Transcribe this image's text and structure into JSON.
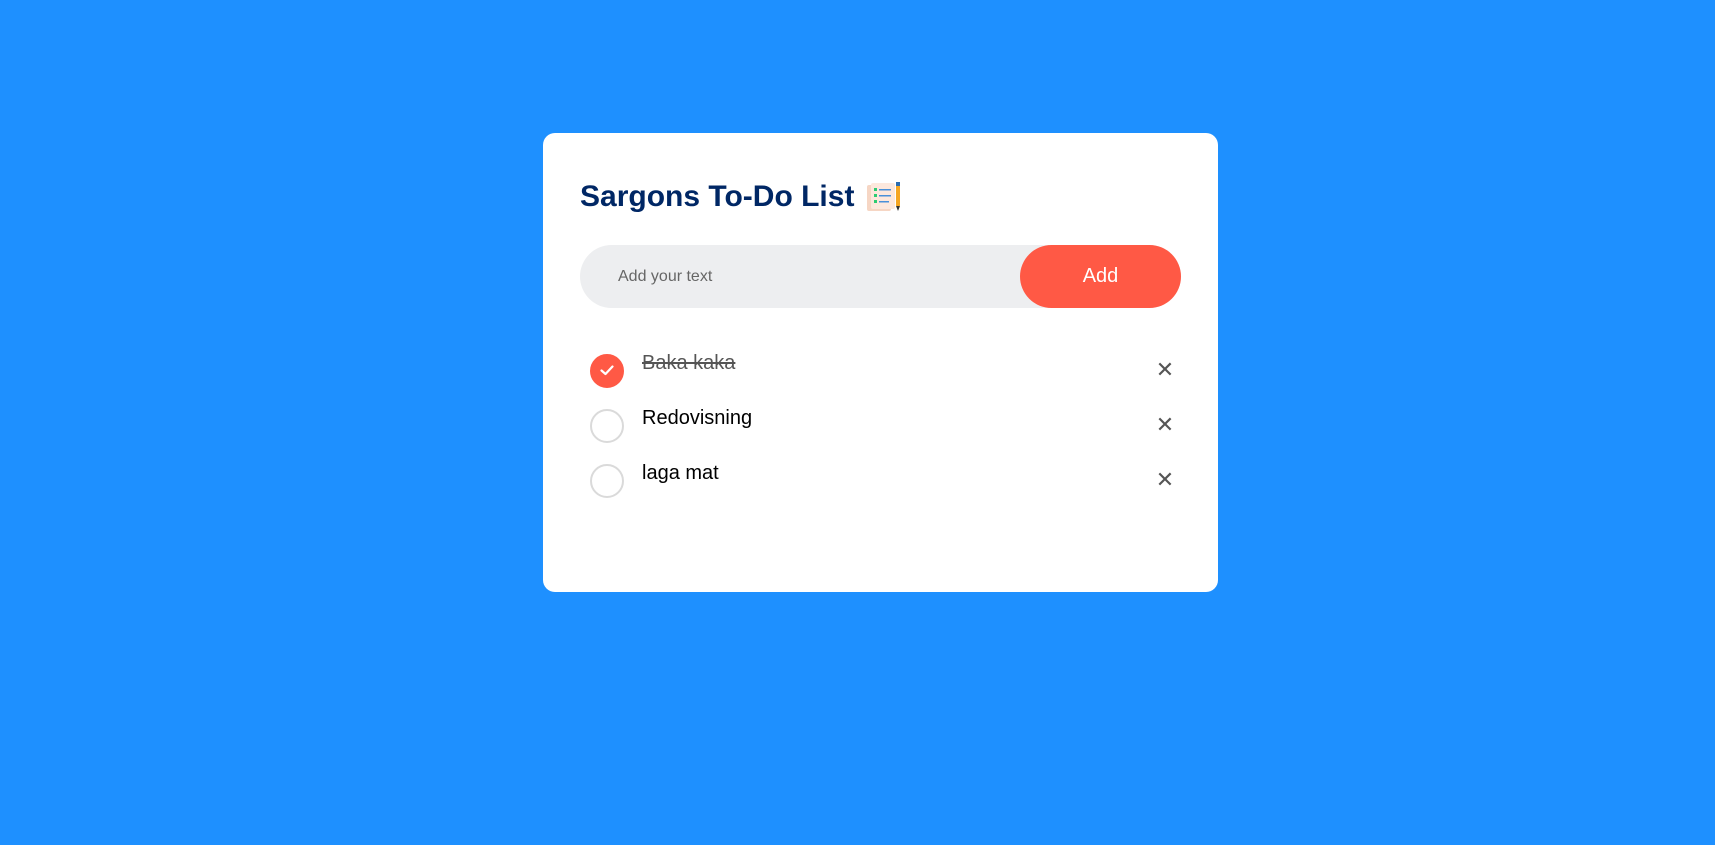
{
  "app": {
    "title": "Sargons To-Do List",
    "title_icon": "notepad-checklist-icon"
  },
  "input": {
    "placeholder": "Add your text",
    "value": "",
    "add_label": "Add"
  },
  "tasks": [
    {
      "text": "Baka kaka",
      "done": true
    },
    {
      "text": "Redovisning",
      "done": false
    },
    {
      "text": "laga mat",
      "done": false
    }
  ],
  "icons": {
    "delete": "close-icon",
    "delete_glyph": "✕",
    "checked": "check-icon"
  },
  "colors": {
    "background": "#1e90ff",
    "accent": "#ff5945",
    "title": "#002765"
  }
}
